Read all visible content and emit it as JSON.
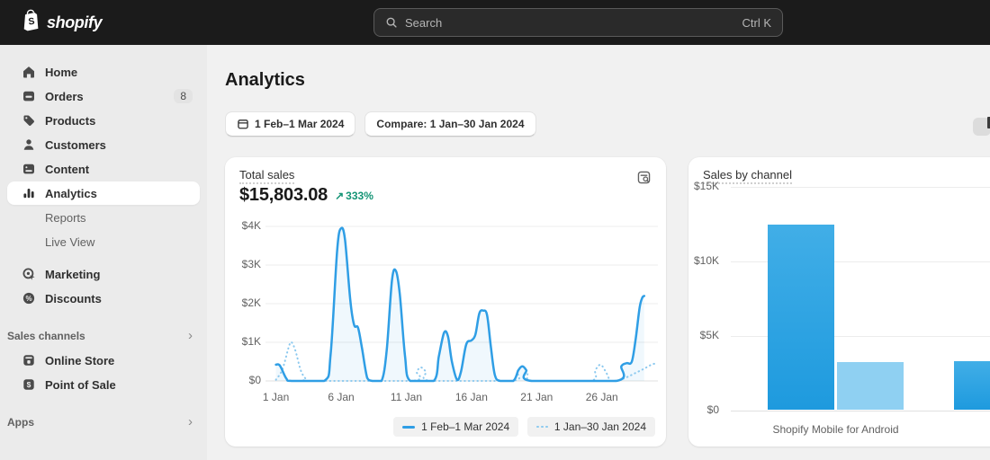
{
  "topbar": {
    "brand": "shopify",
    "search": {
      "placeholder": "Search",
      "shortcut": "Ctrl K"
    }
  },
  "sidebar": {
    "items": [
      {
        "label": "Home",
        "icon": "home-icon"
      },
      {
        "label": "Orders",
        "icon": "orders-icon",
        "badge": "8"
      },
      {
        "label": "Products",
        "icon": "products-icon"
      },
      {
        "label": "Customers",
        "icon": "customers-icon"
      },
      {
        "label": "Content",
        "icon": "content-icon"
      },
      {
        "label": "Analytics",
        "icon": "analytics-icon",
        "selected": true
      },
      {
        "label": "Reports",
        "sub": true
      },
      {
        "label": "Live View",
        "sub": true
      },
      {
        "label": "Marketing",
        "icon": "marketing-icon",
        "gap": true
      },
      {
        "label": "Discounts",
        "icon": "discounts-icon"
      }
    ],
    "sections": [
      {
        "label": "Sales channels",
        "items": [
          {
            "label": "Online Store",
            "icon": "online-store-icon"
          },
          {
            "label": "Point of Sale",
            "icon": "point-of-sale-icon"
          }
        ]
      },
      {
        "label": "Apps",
        "items": []
      }
    ]
  },
  "page": {
    "title": "Analytics",
    "date_range_button": "1 Feb–1 Mar 2024",
    "compare_button": "Compare: 1 Jan–30 Jan 2024"
  },
  "total_sales_card": {
    "title": "Total sales",
    "value": "$15,803.08",
    "change": "333%"
  },
  "sales_by_channel_card": {
    "title": "Sales by channel"
  },
  "colors": {
    "line_solid": "#2f9ee5",
    "line_dotted": "#8cc9ef",
    "bar_dark": "#2ea3e2",
    "bar_light": "#8fd0f2",
    "trend_green": "#149475"
  },
  "chart_data": [
    {
      "type": "line",
      "title": "Total sales",
      "ylim": [
        0,
        4000
      ],
      "yticks": [
        "$4K",
        "$3K",
        "$2K",
        "$1K",
        "$0"
      ],
      "xticks": [
        {
          "day": 1,
          "label": "1 Jan"
        },
        {
          "day": 6,
          "label": "6 Jan"
        },
        {
          "day": 11,
          "label": "11 Jan"
        },
        {
          "day": 16,
          "label": "16 Jan"
        },
        {
          "day": 21,
          "label": "21 Jan"
        },
        {
          "day": 26,
          "label": "26 Jan"
        }
      ],
      "legend": [
        {
          "label": "1 Feb–1 Mar 2024",
          "style": "solid"
        },
        {
          "label": "1 Jan–30 Jan 2024",
          "style": "dotted"
        }
      ],
      "series": [
        {
          "name": "1 Jan–30 Jan 2024",
          "style": "dotted",
          "points": [
            [
              1,
              30
            ],
            [
              1.5,
              300
            ],
            [
              2,
              900
            ],
            [
              2.2,
              1000
            ],
            [
              2.5,
              780
            ],
            [
              2.9,
              280
            ],
            [
              3.3,
              50
            ],
            [
              3.7,
              0
            ],
            [
              11.4,
              0
            ],
            [
              11.8,
              240
            ],
            [
              12.1,
              350
            ],
            [
              12.5,
              240
            ],
            [
              12.9,
              0
            ],
            [
              19.1,
              0
            ],
            [
              19.5,
              240
            ],
            [
              19.9,
              380
            ],
            [
              20.3,
              240
            ],
            [
              20.7,
              0
            ],
            [
              25.1,
              0
            ],
            [
              25.5,
              280
            ],
            [
              25.9,
              420
            ],
            [
              26.3,
              240
            ],
            [
              26.7,
              0
            ],
            [
              27.4,
              30
            ],
            [
              28,
              110
            ],
            [
              28.6,
              210
            ],
            [
              29.2,
              310
            ],
            [
              29.8,
              420
            ],
            [
              30.1,
              450
            ]
          ]
        },
        {
          "name": "1 Feb–1 Mar 2024",
          "style": "solid",
          "points": [
            [
              1,
              420
            ],
            [
              1.3,
              400
            ],
            [
              1.8,
              60
            ],
            [
              2.2,
              0
            ],
            [
              4.7,
              0
            ],
            [
              5.2,
              700
            ],
            [
              5.7,
              3400
            ],
            [
              6,
              3950
            ],
            [
              6.3,
              3650
            ],
            [
              6.7,
              2100
            ],
            [
              7,
              1450
            ],
            [
              7.3,
              1380
            ],
            [
              7.6,
              850
            ],
            [
              8,
              80
            ],
            [
              8.4,
              0
            ],
            [
              9.1,
              0
            ],
            [
              9.5,
              800
            ],
            [
              9.9,
              2600
            ],
            [
              10.2,
              2850
            ],
            [
              10.5,
              2250
            ],
            [
              10.9,
              650
            ],
            [
              11.3,
              0
            ],
            [
              13.1,
              0
            ],
            [
              13.5,
              650
            ],
            [
              13.9,
              1250
            ],
            [
              14.2,
              1150
            ],
            [
              14.5,
              500
            ],
            [
              14.9,
              30
            ],
            [
              15.2,
              250
            ],
            [
              15.6,
              950
            ],
            [
              16,
              1050
            ],
            [
              16.3,
              1200
            ],
            [
              16.6,
              1750
            ],
            [
              16.9,
              1820
            ],
            [
              17.2,
              1700
            ],
            [
              17.5,
              850
            ],
            [
              17.8,
              150
            ],
            [
              18.2,
              0
            ],
            [
              19.2,
              0
            ],
            [
              19.6,
              280
            ],
            [
              19.9,
              380
            ],
            [
              20.2,
              280
            ],
            [
              20.6,
              0
            ],
            [
              27.1,
              0
            ],
            [
              27.5,
              380
            ],
            [
              27.9,
              460
            ],
            [
              28.3,
              500
            ],
            [
              28.6,
              1100
            ],
            [
              28.9,
              1900
            ],
            [
              29.1,
              2150
            ],
            [
              29.25,
              2200
            ]
          ]
        }
      ]
    },
    {
      "type": "bar",
      "title": "Sales by channel",
      "ylim": [
        0,
        15000
      ],
      "yticks": [
        "$15K",
        "$10K",
        "$5K",
        "$0"
      ],
      "categories": [
        "Shopify Mobile for Android",
        ""
      ],
      "series": [
        {
          "name": "1 Feb–1 Mar 2024",
          "values": [
            12400,
            3250
          ]
        },
        {
          "name": "1 Jan–30 Jan 2024",
          "values": [
            3200,
            null
          ]
        }
      ]
    }
  ]
}
